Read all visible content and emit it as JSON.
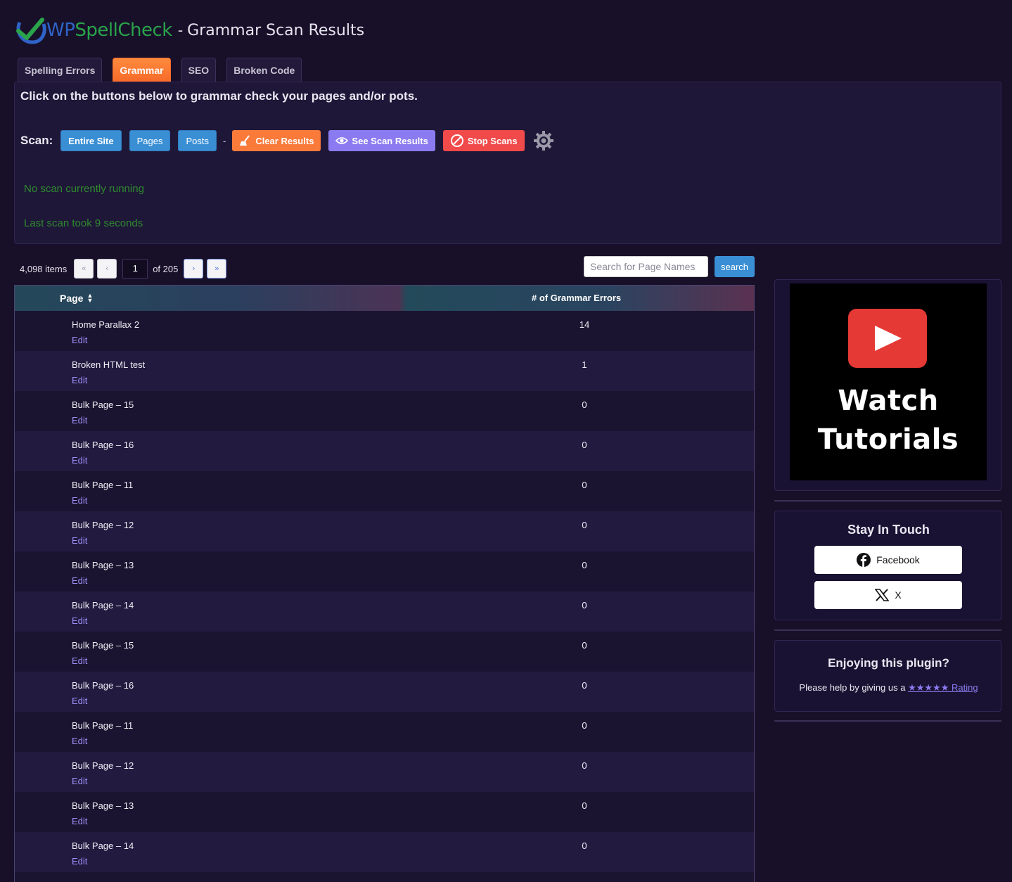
{
  "header": {
    "logo_part1": "WP",
    "logo_part2": "SpellCheck",
    "separator": "-",
    "title": "Grammar Scan Results"
  },
  "tabs": [
    {
      "label": "Spelling Errors",
      "active": false
    },
    {
      "label": "Grammar",
      "active": true
    },
    {
      "label": "SEO",
      "active": false
    },
    {
      "label": "Broken Code",
      "active": false
    }
  ],
  "panel": {
    "intro": "Click on the buttons below to grammar check your pages and/or pots.",
    "scan_label": "Scan:",
    "buttons": {
      "entire_site": "Entire Site",
      "pages": "Pages",
      "posts": "Posts",
      "dash": "-",
      "clear": "Clear Results",
      "see": "See Scan Results",
      "stop": "Stop Scans"
    },
    "status_running": "No scan currently running",
    "status_last": "Last scan took 9 seconds"
  },
  "pager": {
    "count": "4,098 items",
    "first": "«",
    "prev": "‹",
    "current": "1",
    "of_total": "of 205",
    "next": "›",
    "last": "»"
  },
  "search": {
    "placeholder": "Search for Page Names",
    "button": "search"
  },
  "table": {
    "col_page": "Page",
    "col_errors": "# of Grammar Errors",
    "edit_label": "Edit",
    "rows": [
      {
        "name": "Home Parallax 2",
        "errors": "14"
      },
      {
        "name": "Broken HTML test",
        "errors": "1"
      },
      {
        "name": "Bulk Page – 15",
        "errors": "0"
      },
      {
        "name": "Bulk Page – 16",
        "errors": "0"
      },
      {
        "name": "Bulk Page – 11",
        "errors": "0"
      },
      {
        "name": "Bulk Page – 12",
        "errors": "0"
      },
      {
        "name": "Bulk Page – 13",
        "errors": "0"
      },
      {
        "name": "Bulk Page – 14",
        "errors": "0"
      },
      {
        "name": "Bulk Page – 15",
        "errors": "0"
      },
      {
        "name": "Bulk Page – 16",
        "errors": "0"
      },
      {
        "name": "Bulk Page – 11",
        "errors": "0"
      },
      {
        "name": "Bulk Page – 12",
        "errors": "0"
      },
      {
        "name": "Bulk Page – 13",
        "errors": "0"
      },
      {
        "name": "Bulk Page – 14",
        "errors": "0"
      },
      {
        "name": "",
        "errors": ""
      }
    ]
  },
  "sidebar": {
    "video_line1": "Watch",
    "video_line2": "Tutorials",
    "stay_title": "Stay In Touch",
    "facebook": "Facebook",
    "x": "X",
    "enjoy_title": "Enjoying this plugin?",
    "rating_prefix": "Please help by giving us a",
    "rating_link": "★★★★★ Rating"
  },
  "colors": {
    "background": "#181029",
    "accent_orange": "#fa7a3a",
    "accent_blue": "#3a8fd4",
    "accent_purple": "#8a7cf0",
    "accent_red": "#f04a4a",
    "status_green": "#2e8a2e"
  }
}
